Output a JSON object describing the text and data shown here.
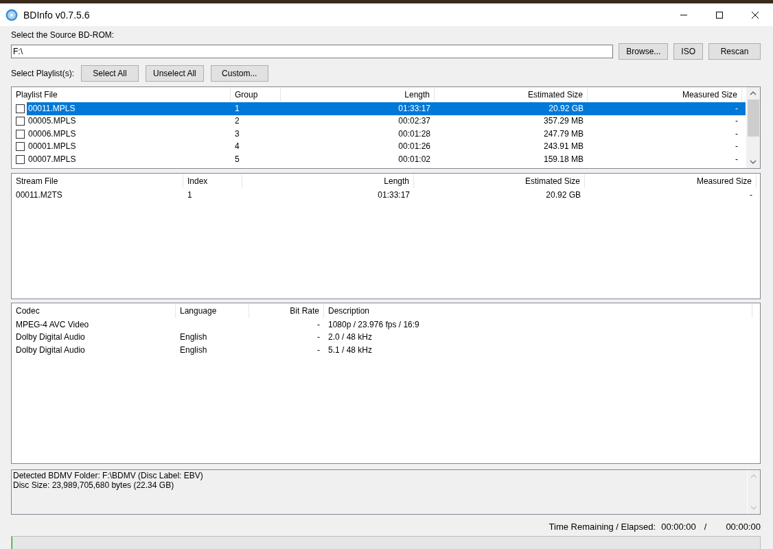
{
  "window": {
    "title": "BDInfo v0.7.5.6"
  },
  "source": {
    "label": "Select the Source BD-ROM:",
    "value": "F:\\"
  },
  "source_buttons": [
    "Browse...",
    "ISO",
    "Rescan"
  ],
  "playlist_select": {
    "label": "Select Playlist(s):",
    "buttons": [
      "Select All",
      "Unselect All",
      "Custom..."
    ]
  },
  "playlists": {
    "columns": [
      "Playlist File",
      "Group",
      "Length",
      "Estimated Size",
      "Measured Size"
    ],
    "rows": [
      {
        "cells": [
          "00011.MPLS",
          "1",
          "01:33:17",
          "20.92 GB",
          "-"
        ],
        "checked": false,
        "selected": true
      },
      {
        "cells": [
          "00005.MPLS",
          "2",
          "00:02:37",
          "357.29 MB",
          "-"
        ],
        "checked": false,
        "selected": false
      },
      {
        "cells": [
          "00006.MPLS",
          "3",
          "00:01:28",
          "247.79 MB",
          "-"
        ],
        "checked": false,
        "selected": false
      },
      {
        "cells": [
          "00001.MPLS",
          "4",
          "00:01:26",
          "243.91 MB",
          "-"
        ],
        "checked": false,
        "selected": false
      },
      {
        "cells": [
          "00007.MPLS",
          "5",
          "00:01:02",
          "159.18 MB",
          "-"
        ],
        "checked": false,
        "selected": false
      }
    ]
  },
  "streams": {
    "columns": [
      "Stream File",
      "Index",
      "Length",
      "Estimated Size",
      "Measured Size"
    ],
    "rows": [
      {
        "cells": [
          "00011.M2TS",
          "1",
          "01:33:17",
          "20.92 GB",
          "-"
        ]
      }
    ]
  },
  "codecs": {
    "columns": [
      "Codec",
      "Language",
      "Bit Rate",
      "Description"
    ],
    "rows": [
      {
        "cells": [
          "MPEG-4 AVC Video",
          "",
          "-",
          "1080p / 23.976 fps / 16:9"
        ]
      },
      {
        "cells": [
          "Dolby Digital Audio",
          "English",
          "-",
          "2.0 / 48 kHz"
        ]
      },
      {
        "cells": [
          "Dolby Digital Audio",
          "English",
          "-",
          "5.1 / 48 kHz"
        ]
      }
    ]
  },
  "report": {
    "lines": [
      "Detected BDMV Folder: F:\\BDMV (Disc Label: EBV)",
      "Disc Size: 23,989,705,680 bytes (22.34 GB)"
    ]
  },
  "status": {
    "label": "Time Remaining / Elapsed:",
    "remaining": "00:00:00",
    "separator": "/",
    "elapsed": "00:00:00"
  },
  "progress": {
    "level": 0
  }
}
